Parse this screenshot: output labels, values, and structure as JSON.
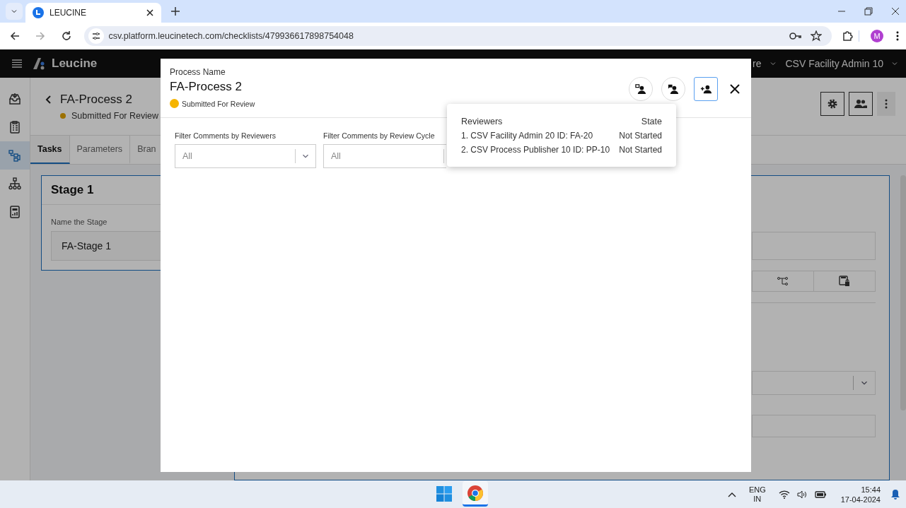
{
  "browser": {
    "tab_title": "LEUCINE",
    "url": "csv.platform.leucinetech.com/checklists/479936617898754048",
    "profile_initial": "M"
  },
  "app": {
    "brand": "Leucine",
    "menu_partial": "re",
    "user": "CSV Facility Admin 10",
    "nav": [
      {
        "kind": "inbox",
        "selected": false
      },
      {
        "kind": "checklist",
        "selected": false
      },
      {
        "kind": "process",
        "selected": true
      },
      {
        "kind": "hierarchy",
        "selected": false
      },
      {
        "kind": "report",
        "selected": false
      }
    ],
    "process": {
      "title": "FA-Process 2",
      "status": "Submitted For Review"
    },
    "tabs": [
      {
        "label": "Tasks",
        "selected": true
      },
      {
        "label": "Parameters",
        "selected": false
      },
      {
        "label": "Bran",
        "selected": false
      }
    ],
    "stage": {
      "title": "Stage 1",
      "field_label": "Name the Stage",
      "field_value": "FA-Stage 1"
    }
  },
  "modal": {
    "caption": "Process Name",
    "title": "FA-Process 2",
    "status": "Submitted For Review",
    "actions": [
      {
        "kind": "reviewers",
        "selected": false
      },
      {
        "kind": "comments",
        "selected": false
      },
      {
        "kind": "add",
        "selected": true
      }
    ],
    "filters": [
      {
        "label": "Filter Comments by Reviewers",
        "placeholder": "All"
      },
      {
        "label": "Filter Comments by Review Cycle",
        "placeholder": "All"
      }
    ],
    "popover": {
      "columns": [
        "Reviewers",
        "State"
      ],
      "rows": [
        {
          "reviewer": "1. CSV Facility Admin 20 ID: FA-20",
          "state": "Not Started"
        },
        {
          "reviewer": "2. CSV Process Publisher 10 ID: PP-10",
          "state": "Not Started"
        }
      ]
    }
  },
  "taskbar": {
    "language": "ENG",
    "region": "IN",
    "time": "15:44",
    "date": "17-04-2024"
  }
}
